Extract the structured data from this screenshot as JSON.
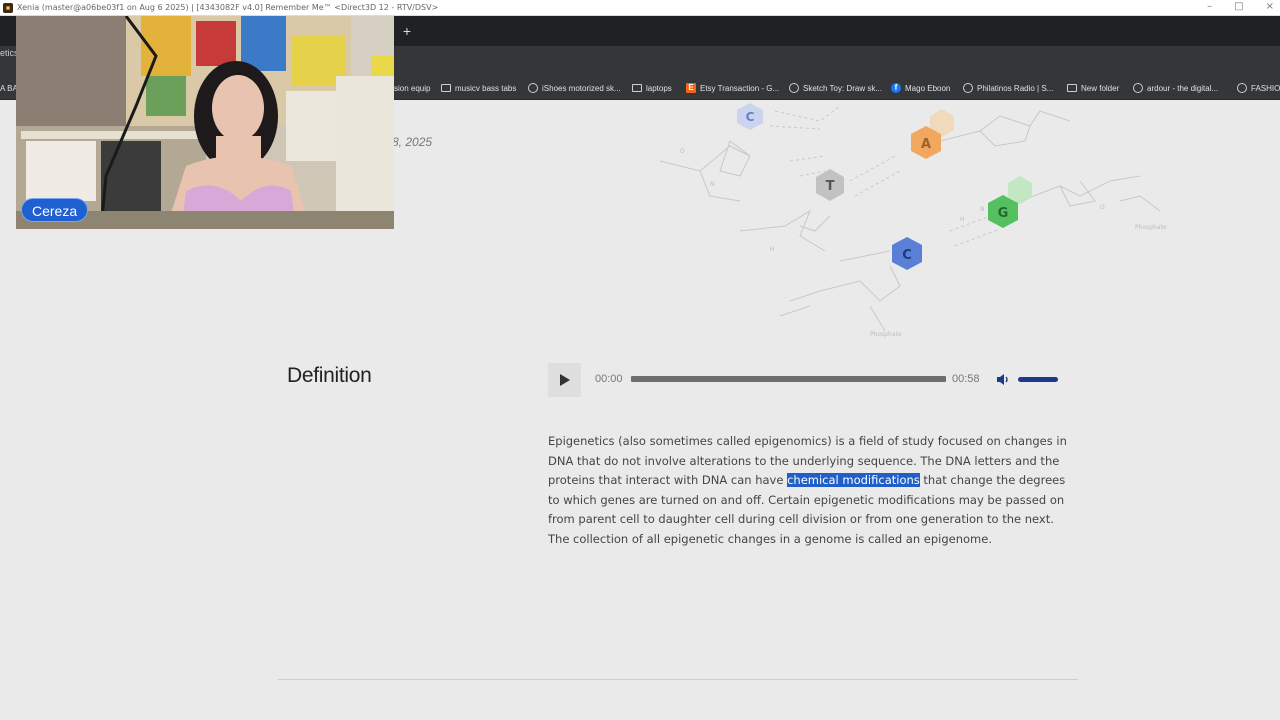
{
  "window": {
    "title": "Xenia (master@a06be03f1 on Aug  6 2025) | [4343082F v4.0] Remember Me™ <Direct3D 12 - RTV/DSV>",
    "controls": {
      "minimize": "–",
      "maximize": "□",
      "close": "×"
    }
  },
  "tabs": {
    "new_tab_label": "+",
    "partial_tab_label": "etics"
  },
  "toolbar": {
    "edge_text": "A BA"
  },
  "bookmarks": [
    {
      "label": "sion equip",
      "icon": "none"
    },
    {
      "label": "musicv bass tabs",
      "icon": "folder-icon"
    },
    {
      "label": "iShoes motorized sk...",
      "icon": "globe-icon"
    },
    {
      "label": "laptops",
      "icon": "folder-icon"
    },
    {
      "label": "Etsy Transaction - G...",
      "icon": "etsy-icon"
    },
    {
      "label": "Sketch Toy: Draw sk...",
      "icon": "globe-icon"
    },
    {
      "label": "Mago Eboon",
      "icon": "facebook-icon"
    },
    {
      "label": "Philatinos Radio | S...",
      "icon": "globe-icon"
    },
    {
      "label": "New folder",
      "icon": "folder-icon"
    },
    {
      "label": "ardour - the digital...",
      "icon": "globe-icon"
    },
    {
      "label": "FASHION",
      "icon": "globe-icon"
    }
  ],
  "article": {
    "date_partial": "8, 2025",
    "section_heading": "Definition",
    "audio": {
      "current_time": "00:00",
      "duration": "00:58",
      "progress": 0,
      "volume": 1.0
    },
    "paragraph": {
      "before": "Epigenetics (also sometimes called epigenomics) is a field of study focused on changes in DNA that do not involve alterations to the underlying sequence. The DNA letters and the proteins that interact with DNA can have ",
      "highlight": "chemical modifications",
      "after": " that change the degrees to which genes are turned on and off. Certain epigenetic modifications may be passed on from parent cell to daughter cell during cell division or from one generation to the next. The collection of all epigenetic changes in a genome is called an epigenome."
    },
    "dna_bases": [
      "C",
      "A",
      "T",
      "G",
      "C"
    ],
    "colors": {
      "base_C_top": "#a7b8e8",
      "base_A": "#f0a860",
      "base_T": "#b5b5b5",
      "base_G": "#55c060",
      "base_C_bottom": "#5a7fd6",
      "highlight": "#1f5fc7"
    }
  },
  "webcam": {
    "name": "Cereza",
    "badge_color": "#1e5fd1"
  }
}
